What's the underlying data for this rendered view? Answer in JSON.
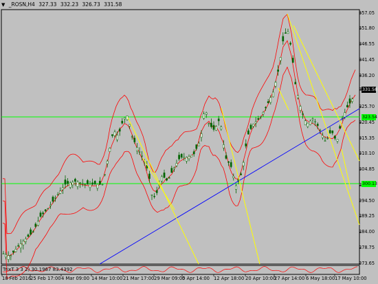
{
  "header": {
    "symbol": "_ROSN,H4",
    "open": "327.33",
    "high": "332.23",
    "low": "326.73",
    "close": "331.58",
    "menu_icon": "triangle-down-icon"
  },
  "indicator_label": "TrixT 3 3 2) 30.1967 83.4392",
  "price_axis": [
    "357.05",
    "351.80",
    "346.55",
    "341.45",
    "336.20",
    "331.58",
    "325.70",
    "320.45",
    "315.35",
    "310.10",
    "304.85",
    "299.60",
    "294.50",
    "289.25",
    "284.00",
    "278.75",
    "273.65"
  ],
  "level_tags": {
    "upper": "323.54",
    "lower": "300.13",
    "current": "331.58"
  },
  "time_axis": [
    "18 Feb 2016",
    "25 Feb 17:00",
    "4 Mar 09:00",
    "14 Mar 10:00",
    "21 Mar 17:00",
    "29 Mar 09:00",
    "5 Apr 14:00",
    "12 Apr 18:00",
    "20 Apr 10:00",
    "27 Apr 14:00",
    "6 May 18:00",
    "17 May 10:00"
  ],
  "colors": {
    "chart_bg": "#c0c0c0",
    "frame": "#000000",
    "candle": "#006400",
    "bollinger": "#ff0000",
    "channel": "#ffff00",
    "trendline": "#0000ff",
    "level_line": "#00ff00",
    "current_tag_bg": "#000000",
    "current_tag_fg": "#ffffff"
  }
}
